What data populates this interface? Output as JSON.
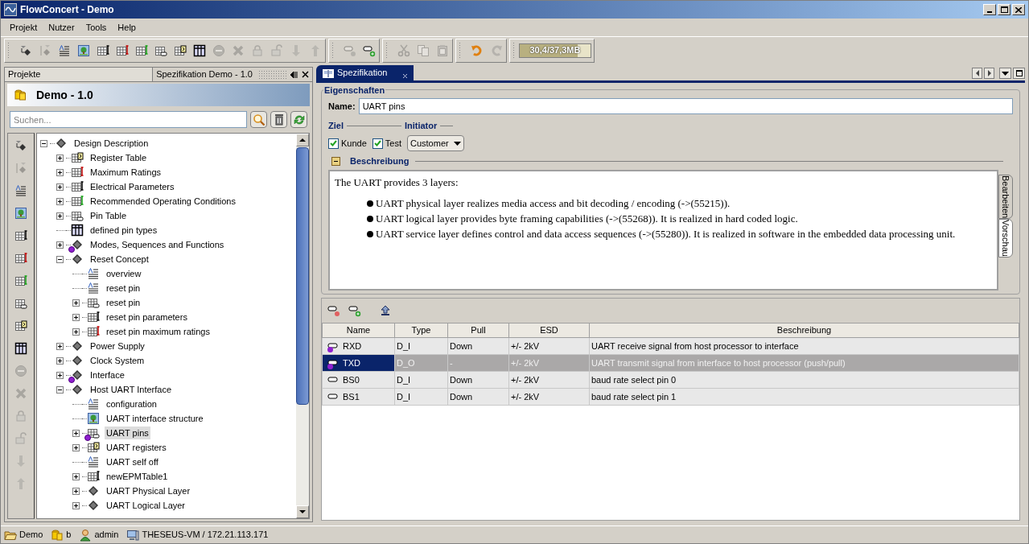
{
  "window": {
    "title": "FlowConcert - Demo"
  },
  "menu": [
    "Projekt",
    "Nutzer",
    "Tools",
    "Help"
  ],
  "toolbar": [
    [
      {
        "kind": "node-add",
        "disabled": false
      },
      {
        "kind": "node-sub",
        "disabled": true
      },
      {
        "kind": "text",
        "disabled": false
      },
      {
        "kind": "image",
        "disabled": false
      },
      {
        "kind": "table-black",
        "disabled": false
      },
      {
        "kind": "table-red",
        "disabled": false
      },
      {
        "kind": "table-green",
        "disabled": false
      },
      {
        "kind": "pin-table",
        "disabled": false
      },
      {
        "kind": "reg-table",
        "disabled": false
      },
      {
        "kind": "grid",
        "disabled": false
      },
      {
        "kind": "remove",
        "disabled": true
      },
      {
        "kind": "delete",
        "disabled": true
      },
      {
        "kind": "lock",
        "disabled": true
      },
      {
        "kind": "unlock",
        "disabled": true
      },
      {
        "kind": "down",
        "disabled": true
      },
      {
        "kind": "up",
        "disabled": true
      }
    ],
    [
      {
        "kind": "pin-remove",
        "disabled": true
      },
      {
        "kind": "pin-add",
        "disabled": false
      }
    ],
    [
      {
        "kind": "cut",
        "disabled": true
      },
      {
        "kind": "copy",
        "disabled": true
      },
      {
        "kind": "paste",
        "disabled": true
      }
    ],
    [
      {
        "kind": "undo",
        "disabled": false
      },
      {
        "kind": "redo",
        "disabled": true
      }
    ]
  ],
  "memory": {
    "reading": "30,4/37,3MB",
    "level": 0.82
  },
  "left_panel": {
    "tabs": [
      {
        "label": "Projekte",
        "selected": false
      },
      {
        "label": "Spezifikation Demo - 1.0",
        "selected": true
      }
    ],
    "project_title": "Demo - 1.0",
    "search": {
      "placeholder": "Suchen..."
    },
    "side_toolbar": [
      {
        "kind": "node-add",
        "disabled": false
      },
      {
        "kind": "node-sub",
        "disabled": true
      },
      {
        "kind": "text",
        "disabled": false
      },
      {
        "kind": "image",
        "disabled": false
      },
      {
        "kind": "table-black",
        "disabled": false
      },
      {
        "kind": "table-red",
        "disabled": false
      },
      {
        "kind": "table-green",
        "disabled": false
      },
      {
        "kind": "pin-table",
        "disabled": false
      },
      {
        "kind": "reg-table",
        "disabled": false
      },
      {
        "kind": "grid",
        "disabled": false
      },
      {
        "kind": "remove",
        "disabled": true
      },
      {
        "kind": "delete",
        "disabled": true
      },
      {
        "kind": "lock",
        "disabled": true
      },
      {
        "kind": "unlock",
        "disabled": true
      },
      {
        "kind": "down",
        "disabled": true
      },
      {
        "kind": "up",
        "disabled": true
      }
    ],
    "tree": [
      {
        "label": "Design Description",
        "kind": "node",
        "expanded": true,
        "selected": false,
        "warning": false,
        "children": [
          {
            "label": "Register Table",
            "kind": "reg-table",
            "expanded": false,
            "selected": false,
            "warning": false
          },
          {
            "label": "Maximum Ratings",
            "kind": "table-red",
            "expanded": false,
            "selected": false,
            "warning": false
          },
          {
            "label": "Electrical Parameters",
            "kind": "table-black",
            "expanded": false,
            "selected": false,
            "warning": false
          },
          {
            "label": "Recommended Operating Conditions",
            "kind": "table-green",
            "expanded": false,
            "selected": false,
            "warning": false
          },
          {
            "label": "Pin Table",
            "kind": "pin-table",
            "expanded": false,
            "selected": false,
            "warning": false
          },
          {
            "label": "defined pin types",
            "kind": "grid",
            "selected": false,
            "warning": false
          },
          {
            "label": "Modes, Sequences and Functions",
            "kind": "node",
            "expanded": false,
            "selected": false,
            "warning": true
          },
          {
            "label": "Reset Concept",
            "kind": "node",
            "expanded": true,
            "selected": false,
            "warning": false,
            "children": [
              {
                "label": "overview",
                "kind": "text",
                "selected": false,
                "warning": false
              },
              {
                "label": "reset pin",
                "kind": "text",
                "selected": false,
                "warning": false
              },
              {
                "label": "reset pin",
                "kind": "pin-table",
                "expanded": false,
                "selected": false,
                "warning": false
              },
              {
                "label": "reset pin parameters",
                "kind": "table-black",
                "expanded": false,
                "selected": false,
                "warning": false
              },
              {
                "label": "reset pin maximum ratings",
                "kind": "table-red",
                "expanded": false,
                "selected": false,
                "warning": false
              }
            ]
          },
          {
            "label": "Power Supply",
            "kind": "node",
            "expanded": false,
            "selected": false,
            "warning": false
          },
          {
            "label": "Clock System",
            "kind": "node",
            "expanded": false,
            "selected": false,
            "warning": false
          },
          {
            "label": "Interface",
            "kind": "node",
            "expanded": false,
            "selected": false,
            "warning": true
          },
          {
            "label": "Host UART Interface",
            "kind": "node",
            "expanded": true,
            "selected": false,
            "warning": false,
            "children": [
              {
                "label": "configuration",
                "kind": "text",
                "selected": false,
                "warning": false
              },
              {
                "label": "UART interface structure",
                "kind": "image",
                "selected": false,
                "warning": false
              },
              {
                "label": "UART pins",
                "kind": "pin-table",
                "expanded": false,
                "selected": true,
                "warning": true
              },
              {
                "label": "UART registers",
                "kind": "reg-table",
                "expanded": false,
                "selected": false,
                "warning": false
              },
              {
                "label": "UART self off",
                "kind": "text",
                "selected": false,
                "warning": false
              },
              {
                "label": "newEPMTable1",
                "kind": "table-black",
                "expanded": false,
                "selected": false,
                "warning": false
              },
              {
                "label": "UART Physical Layer",
                "kind": "node",
                "expanded": false,
                "selected": false,
                "warning": false
              },
              {
                "label": "UART Logical Layer",
                "kind": "node",
                "expanded": false,
                "selected": false,
                "warning": false
              }
            ]
          }
        ]
      }
    ]
  },
  "editor": {
    "tab": {
      "label": "Spezifikation",
      "selected": true
    },
    "properties": {
      "title": "Eigenschaften",
      "name_label": "Name:",
      "name_value": "UART pins",
      "target_title": "Ziel",
      "initiator_title": "Initiator",
      "checkboxes": [
        {
          "label": "Kunde",
          "checked": true
        },
        {
          "label": "Test",
          "checked": true
        }
      ],
      "initiator": "Customer",
      "description_title": "Beschreibung",
      "description": {
        "intro": "The UART provides 3 layers:",
        "bullets": [
          "UART physical layer realizes media access and bit decoding / encoding (->(55215)).",
          "UART logical layer provides byte framing capabilities (->(55268)).  It is realized in hard coded logic.",
          "UART service layer defines control and data access sequences (->(55280)).  It is realized in software in the embedded data processing unit."
        ]
      },
      "side_tabs": [
        {
          "label": "Bearbeiten",
          "selected": false
        },
        {
          "label": "Vorschau",
          "selected": true
        }
      ]
    },
    "table": {
      "columns": [
        "Name",
        "Type",
        "Pull",
        "ESD",
        "Beschreibung"
      ],
      "rows": [
        {
          "name": "RXD",
          "type": "D_I",
          "pull": "Down",
          "esd": "+/- 2kV",
          "description": "UART receive signal from host processor to interface",
          "selected": false,
          "warning": true
        },
        {
          "name": "TXD",
          "type": "D_O",
          "pull": "-",
          "esd": "+/- 2kV",
          "description": "UART transmit signal from interface to host processor (push/pull)",
          "selected": true,
          "warning": true
        },
        {
          "name": "BS0",
          "type": "D_I",
          "pull": "Down",
          "esd": "+/- 2kV",
          "description": "baud rate select pin 0",
          "selected": false,
          "warning": false
        },
        {
          "name": "BS1",
          "type": "D_I",
          "pull": "Down",
          "esd": "+/- 2kV",
          "description": "baud rate select pin 1",
          "selected": false,
          "warning": false
        }
      ]
    }
  },
  "status_bar": [
    {
      "kind": "folder",
      "text": "Demo"
    },
    {
      "kind": "database",
      "text": "b"
    },
    {
      "kind": "user",
      "text": "admin"
    },
    {
      "kind": "computer",
      "text": "THESEUS-VM / 172.21.113.171"
    }
  ]
}
